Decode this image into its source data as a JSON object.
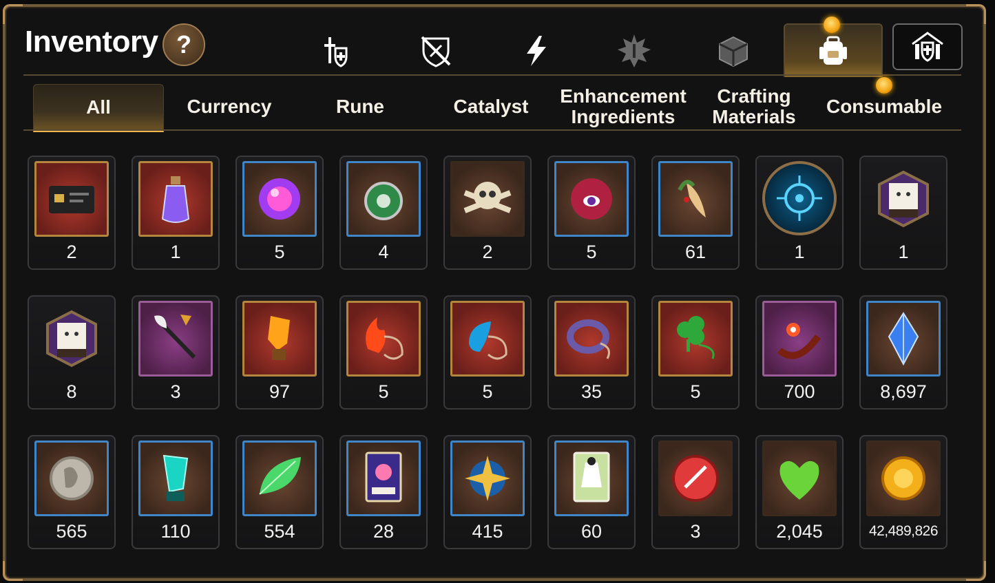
{
  "header": {
    "title": "Inventory",
    "help_label": "?"
  },
  "category_tabs": [
    {
      "icon": "sword-shield-icon"
    },
    {
      "icon": "crossed-shield-icon"
    },
    {
      "icon": "lightning-icon"
    },
    {
      "icon": "spiky-emblem-icon"
    },
    {
      "icon": "cube-icon"
    },
    {
      "icon": "backpack-icon",
      "active": true
    },
    {
      "icon": "building-shield-icon"
    }
  ],
  "sub_tabs": [
    {
      "label": "All",
      "active": true
    },
    {
      "label": "Currency"
    },
    {
      "label": "Rune"
    },
    {
      "label": "Catalyst"
    },
    {
      "label": "Enhancement Ingredients"
    },
    {
      "label": "Crafting Materials"
    },
    {
      "label": "Consumable"
    }
  ],
  "items": [
    {
      "icon": "id-card-icon",
      "qty": "2",
      "frame": "red"
    },
    {
      "icon": "potion-bottle-icon",
      "qty": "1",
      "frame": "red"
    },
    {
      "icon": "magic-orb-icon",
      "qty": "5",
      "frame": "blue"
    },
    {
      "icon": "green-amulet-icon",
      "qty": "4",
      "frame": "blue"
    },
    {
      "icon": "skull-crossbones-icon",
      "qty": "2",
      "frame": "brown"
    },
    {
      "icon": "eye-orb-icon",
      "qty": "5",
      "frame": "blue"
    },
    {
      "icon": "ginseng-root-icon",
      "qty": "61",
      "frame": "blue"
    },
    {
      "icon": "rune-circle-icon",
      "qty": "1",
      "frame": "round"
    },
    {
      "icon": "pet-box-icon",
      "qty": "1",
      "frame": "hex"
    },
    {
      "icon": "pet-box-icon",
      "qty": "8",
      "frame": "hex"
    },
    {
      "icon": "feather-wand-icon",
      "qty": "3",
      "frame": "purple"
    },
    {
      "icon": "amber-crystal-icon",
      "qty": "97",
      "frame": "red"
    },
    {
      "icon": "fire-pendant-icon",
      "qty": "5",
      "frame": "red"
    },
    {
      "icon": "water-pendant-icon",
      "qty": "5",
      "frame": "red"
    },
    {
      "icon": "ring-pendant-icon",
      "qty": "35",
      "frame": "red"
    },
    {
      "icon": "clover-pendant-icon",
      "qty": "5",
      "frame": "red"
    },
    {
      "icon": "flower-bracelet-icon",
      "qty": "700",
      "frame": "purple"
    },
    {
      "icon": "blue-gem-icon",
      "qty": "8,697",
      "frame": "blue"
    },
    {
      "icon": "silver-coin-icon",
      "qty": "565",
      "frame": "blue"
    },
    {
      "icon": "teal-crystal-icon",
      "qty": "110",
      "frame": "blue"
    },
    {
      "icon": "green-leaf-icon",
      "qty": "554",
      "frame": "blue"
    },
    {
      "icon": "pet-card-icon",
      "qty": "28",
      "frame": "blue"
    },
    {
      "icon": "star-compass-icon",
      "qty": "415",
      "frame": "blue"
    },
    {
      "icon": "costume-card-icon",
      "qty": "60",
      "frame": "blue"
    },
    {
      "icon": "red-seal-icon",
      "qty": "3",
      "frame": "brown"
    },
    {
      "icon": "green-heart-icon",
      "qty": "2,045",
      "frame": "brown"
    },
    {
      "icon": "gold-coin-icon",
      "qty": "42,489,826",
      "frame": "brown"
    }
  ],
  "colors": {
    "accent_gold": "#f1b64a",
    "frame_brown": "#6f5a3a",
    "notification_dot": "#f3a312"
  }
}
